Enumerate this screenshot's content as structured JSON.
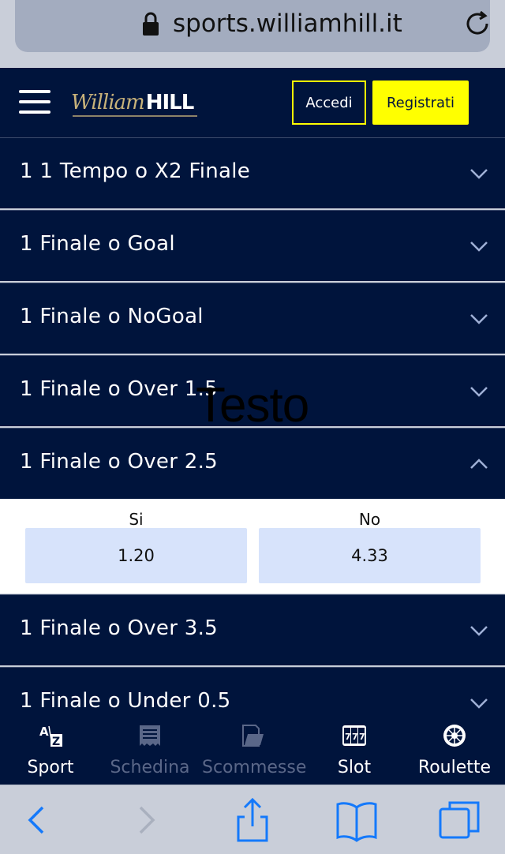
{
  "browser": {
    "url": "sports.williamhill.it"
  },
  "header": {
    "logo_script": "William",
    "logo_bold": "HILL",
    "login_label": "Accedi",
    "register_label": "Registrati",
    "accent_color": "#ffff00",
    "brand_color": "#00143c"
  },
  "markets": [
    {
      "title": "1 1 Tempo o X2 Finale",
      "expanded": false
    },
    {
      "title": "1 Finale o Goal",
      "expanded": false
    },
    {
      "title": "1 Finale o NoGoal",
      "expanded": false
    },
    {
      "title": "1 Finale o Over 1.5",
      "expanded": false
    },
    {
      "title": "1 Finale o Over 2.5",
      "expanded": true
    },
    {
      "title": "1 Finale o Over 3.5",
      "expanded": false
    },
    {
      "title": "1 Finale o Under 0.5",
      "expanded": false
    }
  ],
  "expanded_market": {
    "selections": [
      {
        "label": "Si",
        "odds": "1.20"
      },
      {
        "label": "No",
        "odds": "4.33"
      }
    ]
  },
  "overlay_text": "Testo",
  "tabbar": {
    "tabs": [
      {
        "label": "Sport",
        "icon": "az-icon",
        "enabled": true
      },
      {
        "label": "Schedina",
        "icon": "receipt-icon",
        "enabled": false
      },
      {
        "label": "Scommesse",
        "icon": "bets-icon",
        "enabled": false
      },
      {
        "label": "Slot",
        "icon": "slot-777-icon",
        "enabled": true
      },
      {
        "label": "Roulette",
        "icon": "roulette-icon",
        "enabled": true
      }
    ]
  }
}
